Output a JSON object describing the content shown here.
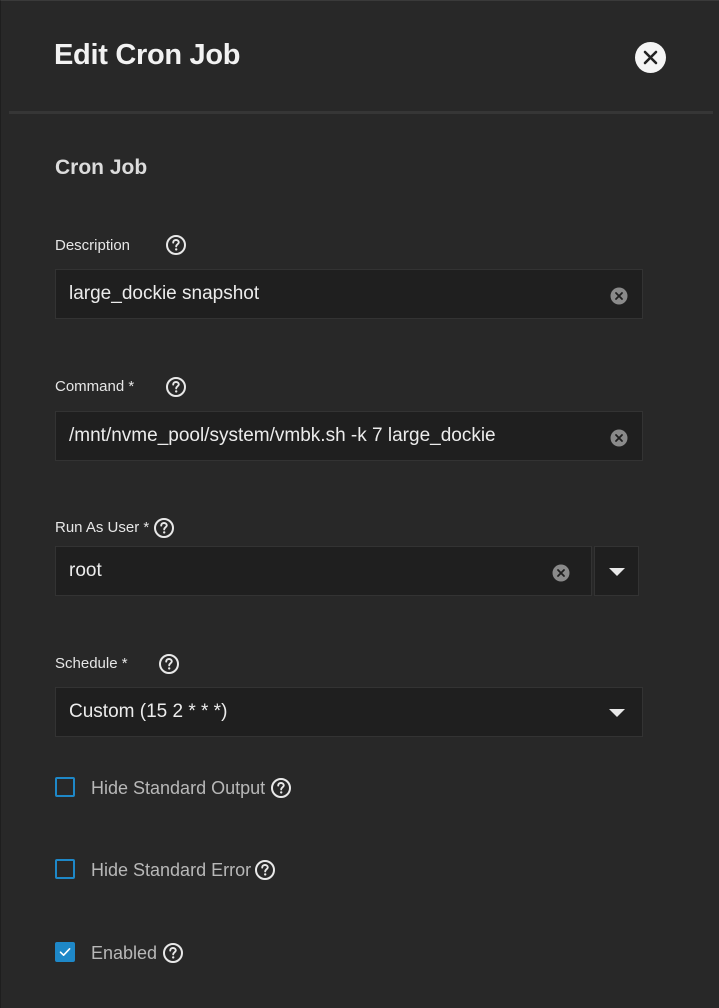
{
  "dialog": {
    "title": "Edit Cron Job",
    "section_title": "Cron Job"
  },
  "description": {
    "label": "Description",
    "value": "large_dockie snapshot"
  },
  "command": {
    "label": "Command *",
    "value": "/mnt/nvme_pool/system/vmbk.sh -k 7 large_dockie"
  },
  "run_as_user": {
    "label": "Run As User *",
    "value": "root"
  },
  "schedule": {
    "label": "Schedule *",
    "value": "Custom (15 2 * * *)"
  },
  "checkboxes": {
    "hide_stdout": {
      "label": "Hide Standard Output",
      "checked": false
    },
    "hide_stderr": {
      "label": "Hide Standard Error",
      "checked": false
    },
    "enabled": {
      "label": "Enabled",
      "checked": true
    }
  },
  "colors": {
    "background": "#282828",
    "field_background": "#1f1f1f",
    "accent": "#1e88c8"
  }
}
